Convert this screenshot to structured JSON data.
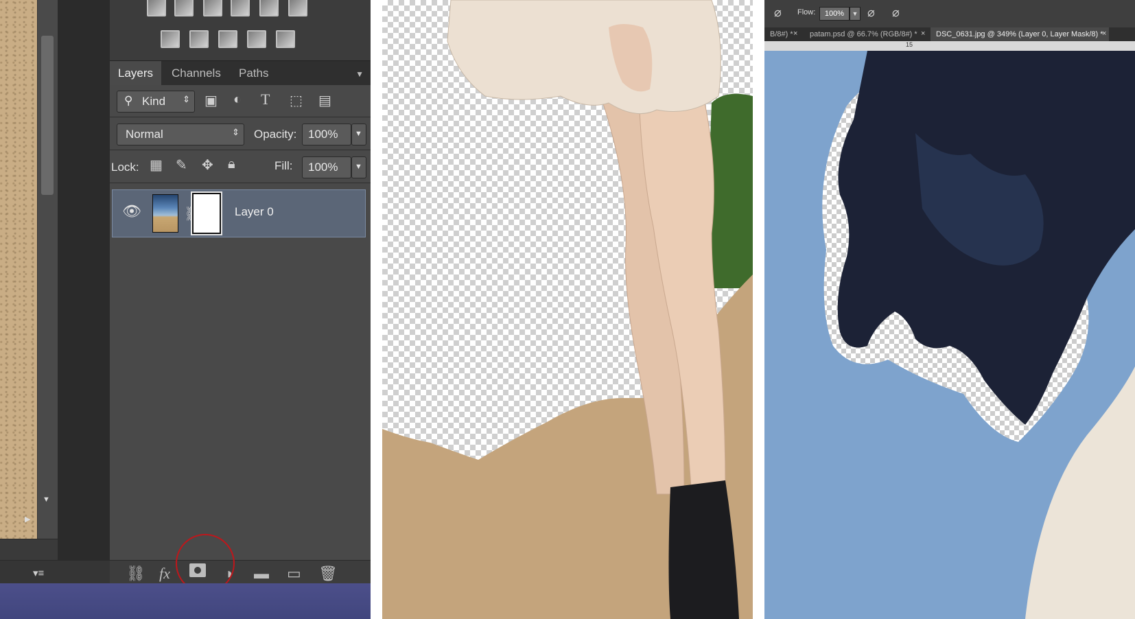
{
  "layers_panel": {
    "tabs": [
      {
        "label": "Layers",
        "active": true
      },
      {
        "label": "Channels",
        "active": false
      },
      {
        "label": "Paths",
        "active": false
      }
    ],
    "filter": {
      "label": "Kind"
    },
    "blend_mode": "Normal",
    "opacity": {
      "label": "Opacity:",
      "value": "100%"
    },
    "lock_label": "Lock:",
    "fill": {
      "label": "Fill:",
      "value": "100%"
    },
    "layers": [
      {
        "name": "Layer 0",
        "visible": true,
        "has_mask": true,
        "selected": true
      }
    ],
    "footer_buttons": [
      "link-layers",
      "fx",
      "add-layer-mask",
      "new-adjustment-layer",
      "new-group",
      "new-layer",
      "delete-layer"
    ],
    "highlighted_button": "add-layer-mask",
    "highlight_color": "#c0161b"
  },
  "document_window": {
    "options_bar": {
      "flow_label": "Flow:",
      "flow_value": "100%"
    },
    "doc_tabs": [
      {
        "label": "B/8#) *",
        "active": false
      },
      {
        "label": "patam.psd @ 66.7% (RGB/8#) *",
        "active": false
      },
      {
        "label": "DSC_0631.jpg @ 349% (Layer 0, Layer Mask/8) *",
        "active": true
      }
    ],
    "ruler_mark": "15"
  },
  "colors": {
    "panel_bg": "#494949",
    "selected_layer": "#5b6677",
    "sky": "#7fa5cf",
    "sand": "#c9ad85"
  }
}
